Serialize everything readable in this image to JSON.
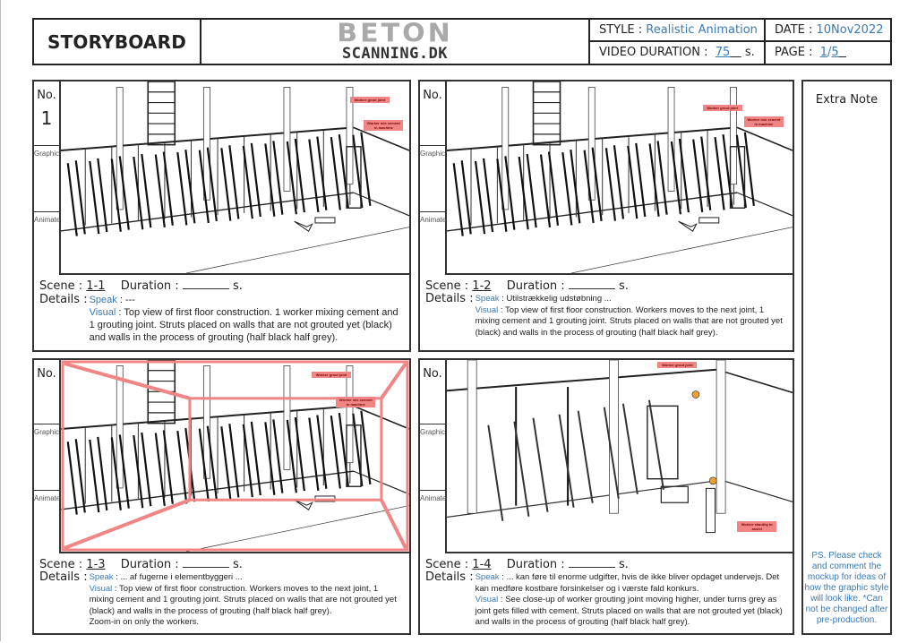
{
  "header": {
    "title": "STORYBOARD",
    "logo_line1": "BETON",
    "logo_line2": "SCANNING.DK",
    "style_label": "STYLE :",
    "style_value": "Realistic Animation",
    "date_label": "DATE :",
    "date_value": "10Nov2022",
    "duration_label": "VIDEO DURATION :",
    "duration_value": "75",
    "duration_unit": "s.",
    "page_label": "PAGE :",
    "page_current": "1",
    "page_sep": "/",
    "page_total": "5"
  },
  "labels": {
    "no": "No.",
    "graphic": "Graphic",
    "animate": "Animate",
    "scene": "Scene :",
    "duration": "Duration :",
    "sec": "s.",
    "details": "Details :",
    "speak": "Speak",
    "visual": "Visual"
  },
  "panels": [
    {
      "number": "1",
      "scene": "1-1",
      "speak": " : ---",
      "visual": " : Top view of first floor construction. 1 worker mixing cement and 1 grouting joint. Struts placed on walls that are not grouted yet (black) and walls in the process of grouting (half black half grey).",
      "tags": [
        "Worker grout joint",
        "Worker mix cement in machine"
      ]
    },
    {
      "number": "",
      "scene": "1-2",
      "speak": " : Utilstrækkelig udstøbning ...",
      "visual": " : Top view of first floor construction. Workers moves to the next joint, 1 mixing cement and 1 grouting joint. Struts placed on walls that are not grouted yet (black) and walls in the process of grouting (half black half grey).",
      "tags": [
        "Worker grout joint",
        "Worker mix cement in machine"
      ]
    },
    {
      "number": "",
      "scene": "1-3",
      "speak": " : ... af fugerne i elementbyggeri ...",
      "visual": " : Top view of first floor construction. Workers moves to the next joint, 1 mixing cement and 1 grouting joint. Struts placed on walls that are not grouted yet (black) and walls in the process of grouting (half black half grey).",
      "visual_extra": "Zoom-in on only the workers.",
      "tags": [
        "Worker grout joint",
        "Worker mix cement in machine"
      ]
    },
    {
      "number": "",
      "scene": "1-4",
      "speak": " : ... kan føre til enorme udgifter, hvis de ikke bliver opdaget undervejs. Det kan medføre kostbare forsinkelser og i værste fald konkurs.",
      "visual": " : See close-up of worker grouting joint moving higher, under turns grey as joint gets filled with cement. Struts placed on walls that are not grouted yet (black) and walls in the process of grouting (half black half grey).",
      "tags": [
        "Worker grout joint",
        "Worker standby to assist"
      ]
    }
  ],
  "extra_note": {
    "title": "Extra Note",
    "note": "PS. Please check and comment the mockup for ideas of how the graphic style will look like. *Can not be changed after pre-production."
  },
  "colors": {
    "accent_blue": "#3a7ab5",
    "zoom_frame": "#f08585"
  }
}
